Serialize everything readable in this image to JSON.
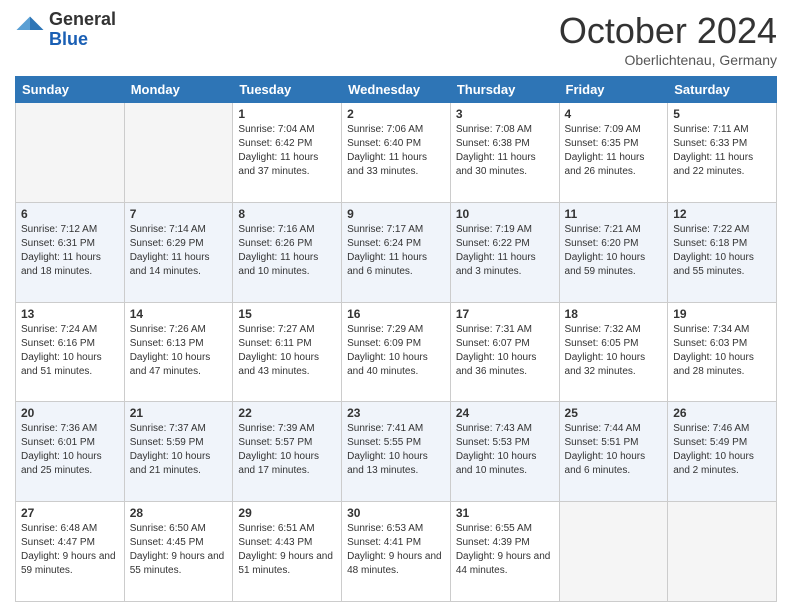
{
  "logo": {
    "general": "General",
    "blue": "Blue"
  },
  "title": "October 2024",
  "subtitle": "Oberlichtenau, Germany",
  "days_of_week": [
    "Sunday",
    "Monday",
    "Tuesday",
    "Wednesday",
    "Thursday",
    "Friday",
    "Saturday"
  ],
  "weeks": [
    [
      {
        "day": "",
        "sunrise": "",
        "sunset": "",
        "daylight": ""
      },
      {
        "day": "",
        "sunrise": "",
        "sunset": "",
        "daylight": ""
      },
      {
        "day": "1",
        "sunrise": "Sunrise: 7:04 AM",
        "sunset": "Sunset: 6:42 PM",
        "daylight": "Daylight: 11 hours and 37 minutes."
      },
      {
        "day": "2",
        "sunrise": "Sunrise: 7:06 AM",
        "sunset": "Sunset: 6:40 PM",
        "daylight": "Daylight: 11 hours and 33 minutes."
      },
      {
        "day": "3",
        "sunrise": "Sunrise: 7:08 AM",
        "sunset": "Sunset: 6:38 PM",
        "daylight": "Daylight: 11 hours and 30 minutes."
      },
      {
        "day": "4",
        "sunrise": "Sunrise: 7:09 AM",
        "sunset": "Sunset: 6:35 PM",
        "daylight": "Daylight: 11 hours and 26 minutes."
      },
      {
        "day": "5",
        "sunrise": "Sunrise: 7:11 AM",
        "sunset": "Sunset: 6:33 PM",
        "daylight": "Daylight: 11 hours and 22 minutes."
      }
    ],
    [
      {
        "day": "6",
        "sunrise": "Sunrise: 7:12 AM",
        "sunset": "Sunset: 6:31 PM",
        "daylight": "Daylight: 11 hours and 18 minutes."
      },
      {
        "day": "7",
        "sunrise": "Sunrise: 7:14 AM",
        "sunset": "Sunset: 6:29 PM",
        "daylight": "Daylight: 11 hours and 14 minutes."
      },
      {
        "day": "8",
        "sunrise": "Sunrise: 7:16 AM",
        "sunset": "Sunset: 6:26 PM",
        "daylight": "Daylight: 11 hours and 10 minutes."
      },
      {
        "day": "9",
        "sunrise": "Sunrise: 7:17 AM",
        "sunset": "Sunset: 6:24 PM",
        "daylight": "Daylight: 11 hours and 6 minutes."
      },
      {
        "day": "10",
        "sunrise": "Sunrise: 7:19 AM",
        "sunset": "Sunset: 6:22 PM",
        "daylight": "Daylight: 11 hours and 3 minutes."
      },
      {
        "day": "11",
        "sunrise": "Sunrise: 7:21 AM",
        "sunset": "Sunset: 6:20 PM",
        "daylight": "Daylight: 10 hours and 59 minutes."
      },
      {
        "day": "12",
        "sunrise": "Sunrise: 7:22 AM",
        "sunset": "Sunset: 6:18 PM",
        "daylight": "Daylight: 10 hours and 55 minutes."
      }
    ],
    [
      {
        "day": "13",
        "sunrise": "Sunrise: 7:24 AM",
        "sunset": "Sunset: 6:16 PM",
        "daylight": "Daylight: 10 hours and 51 minutes."
      },
      {
        "day": "14",
        "sunrise": "Sunrise: 7:26 AM",
        "sunset": "Sunset: 6:13 PM",
        "daylight": "Daylight: 10 hours and 47 minutes."
      },
      {
        "day": "15",
        "sunrise": "Sunrise: 7:27 AM",
        "sunset": "Sunset: 6:11 PM",
        "daylight": "Daylight: 10 hours and 43 minutes."
      },
      {
        "day": "16",
        "sunrise": "Sunrise: 7:29 AM",
        "sunset": "Sunset: 6:09 PM",
        "daylight": "Daylight: 10 hours and 40 minutes."
      },
      {
        "day": "17",
        "sunrise": "Sunrise: 7:31 AM",
        "sunset": "Sunset: 6:07 PM",
        "daylight": "Daylight: 10 hours and 36 minutes."
      },
      {
        "day": "18",
        "sunrise": "Sunrise: 7:32 AM",
        "sunset": "Sunset: 6:05 PM",
        "daylight": "Daylight: 10 hours and 32 minutes."
      },
      {
        "day": "19",
        "sunrise": "Sunrise: 7:34 AM",
        "sunset": "Sunset: 6:03 PM",
        "daylight": "Daylight: 10 hours and 28 minutes."
      }
    ],
    [
      {
        "day": "20",
        "sunrise": "Sunrise: 7:36 AM",
        "sunset": "Sunset: 6:01 PM",
        "daylight": "Daylight: 10 hours and 25 minutes."
      },
      {
        "day": "21",
        "sunrise": "Sunrise: 7:37 AM",
        "sunset": "Sunset: 5:59 PM",
        "daylight": "Daylight: 10 hours and 21 minutes."
      },
      {
        "day": "22",
        "sunrise": "Sunrise: 7:39 AM",
        "sunset": "Sunset: 5:57 PM",
        "daylight": "Daylight: 10 hours and 17 minutes."
      },
      {
        "day": "23",
        "sunrise": "Sunrise: 7:41 AM",
        "sunset": "Sunset: 5:55 PM",
        "daylight": "Daylight: 10 hours and 13 minutes."
      },
      {
        "day": "24",
        "sunrise": "Sunrise: 7:43 AM",
        "sunset": "Sunset: 5:53 PM",
        "daylight": "Daylight: 10 hours and 10 minutes."
      },
      {
        "day": "25",
        "sunrise": "Sunrise: 7:44 AM",
        "sunset": "Sunset: 5:51 PM",
        "daylight": "Daylight: 10 hours and 6 minutes."
      },
      {
        "day": "26",
        "sunrise": "Sunrise: 7:46 AM",
        "sunset": "Sunset: 5:49 PM",
        "daylight": "Daylight: 10 hours and 2 minutes."
      }
    ],
    [
      {
        "day": "27",
        "sunrise": "Sunrise: 6:48 AM",
        "sunset": "Sunset: 4:47 PM",
        "daylight": "Daylight: 9 hours and 59 minutes."
      },
      {
        "day": "28",
        "sunrise": "Sunrise: 6:50 AM",
        "sunset": "Sunset: 4:45 PM",
        "daylight": "Daylight: 9 hours and 55 minutes."
      },
      {
        "day": "29",
        "sunrise": "Sunrise: 6:51 AM",
        "sunset": "Sunset: 4:43 PM",
        "daylight": "Daylight: 9 hours and 51 minutes."
      },
      {
        "day": "30",
        "sunrise": "Sunrise: 6:53 AM",
        "sunset": "Sunset: 4:41 PM",
        "daylight": "Daylight: 9 hours and 48 minutes."
      },
      {
        "day": "31",
        "sunrise": "Sunrise: 6:55 AM",
        "sunset": "Sunset: 4:39 PM",
        "daylight": "Daylight: 9 hours and 44 minutes."
      },
      {
        "day": "",
        "sunrise": "",
        "sunset": "",
        "daylight": ""
      },
      {
        "day": "",
        "sunrise": "",
        "sunset": "",
        "daylight": ""
      }
    ]
  ]
}
